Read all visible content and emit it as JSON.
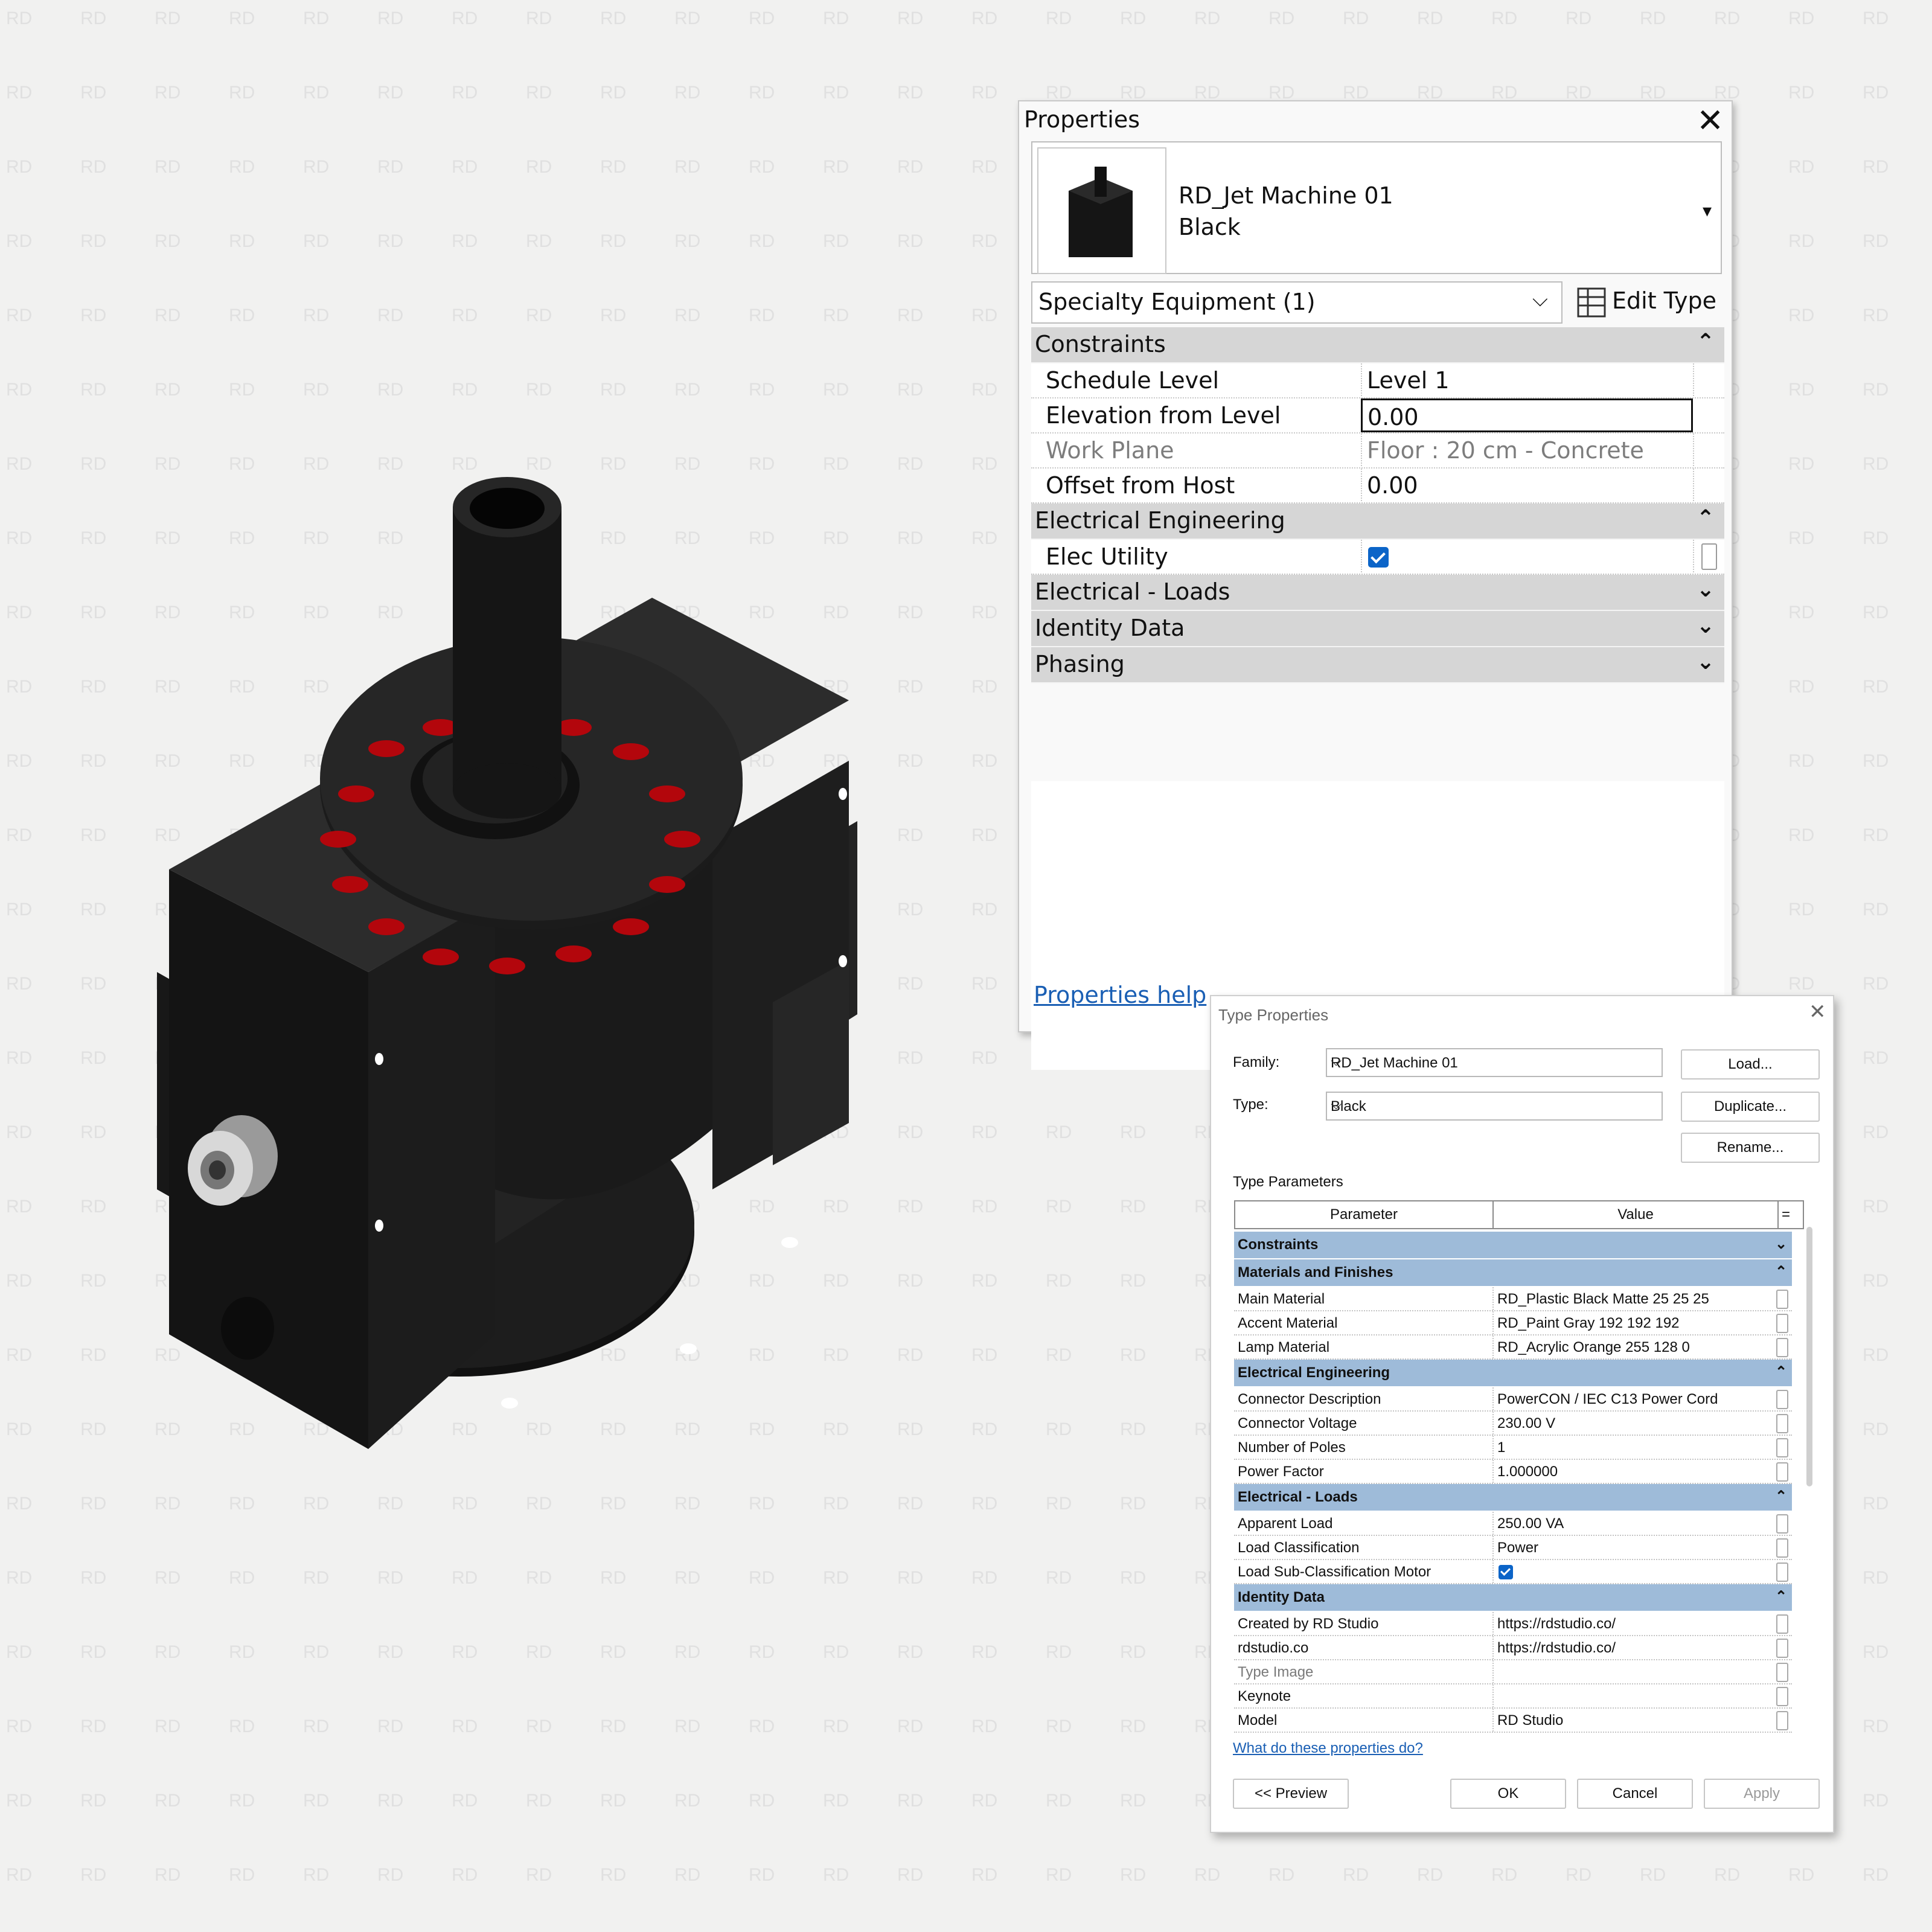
{
  "watermark": {
    "text": "RD",
    "color": "#e0e0e0"
  },
  "properties": {
    "title": "Properties",
    "close_glyph": "✕",
    "type_name_line1": "RD_Jet Machine 01",
    "type_name_line2": "Black",
    "type_dropdown_glyph": "▾",
    "category": "Specialty Equipment (1)",
    "category_glyph": "⌵",
    "edit_type_label": "Edit Type",
    "groups": {
      "constraints": "Constraints",
      "electrical_engineering": "Electrical Engineering",
      "electrical_loads": "Electrical - Loads",
      "identity_data": "Identity Data",
      "phasing": "Phasing"
    },
    "collapse_glyph": "⌃",
    "expand_glyph": "⌄",
    "rows": {
      "schedule_level": {
        "label": "Schedule Level",
        "value": "Level 1"
      },
      "elevation_from_level": {
        "label": "Elevation from Level",
        "value": "0.00"
      },
      "work_plane": {
        "label": "Work Plane",
        "value": "Floor : 20 cm - Concrete"
      },
      "offset_from_host": {
        "label": "Offset from Host",
        "value": "0.00"
      },
      "elec_utility": {
        "label": "Elec Utility",
        "checked": true
      }
    },
    "help_link": "Properties help"
  },
  "type_properties": {
    "title": "Type Properties",
    "close_glyph": "✕",
    "family_label": "Family:",
    "family_value": "RD_Jet Machine 01",
    "type_label": "Type:",
    "type_value": "Black",
    "combo_glyph": "⌵",
    "load_button": "Load...",
    "duplicate_button": "Duplicate...",
    "rename_button": "Rename...",
    "section_label": "Type Parameters",
    "col_parameter": "Parameter",
    "col_value": "Value",
    "col_eq": "=",
    "groups": {
      "constraints": "Constraints",
      "materials": "Materials and Finishes",
      "electrical_engineering": "Electrical Engineering",
      "electrical_loads": "Electrical - Loads",
      "identity_data": "Identity Data"
    },
    "materials_rows": [
      {
        "p": "Main Material",
        "v": "RD_Plastic Black Matte 25 25 25"
      },
      {
        "p": "Accent Material",
        "v": "RD_Paint Gray 192 192 192"
      },
      {
        "p": "Lamp Material",
        "v": "RD_Acrylic Orange 255 128 0"
      }
    ],
    "electrical_rows": [
      {
        "p": "Connector Description",
        "v": "PowerCON / IEC C13 Power Cord"
      },
      {
        "p": "Connector Voltage",
        "v": "230.00 V"
      },
      {
        "p": "Number of Poles",
        "v": "1"
      },
      {
        "p": "Power Factor",
        "v": "1.000000"
      }
    ],
    "loads_rows": [
      {
        "p": "Apparent Load",
        "v": "250.00 VA"
      },
      {
        "p": "Load Classification",
        "v": "Power"
      },
      {
        "p": "Load Sub-Classification Motor",
        "checked": true
      }
    ],
    "identity_rows": [
      {
        "p": "Created by RD Studio",
        "v": "https://rdstudio.co/"
      },
      {
        "p": "rdstudio.co",
        "v": "https://rdstudio.co/"
      },
      {
        "p": "Type Image",
        "v": ""
      },
      {
        "p": "Keynote",
        "v": ""
      },
      {
        "p": "Model",
        "v": "RD Studio"
      }
    ],
    "help_link": "What do these properties do?",
    "preview_button": "<< Preview",
    "ok_button": "OK",
    "cancel_button": "Cancel",
    "apply_button": "Apply"
  },
  "colors": {
    "accent": "#0b64c8",
    "group_header": "#9ebbd9",
    "lamp_red": "#b3060c"
  }
}
